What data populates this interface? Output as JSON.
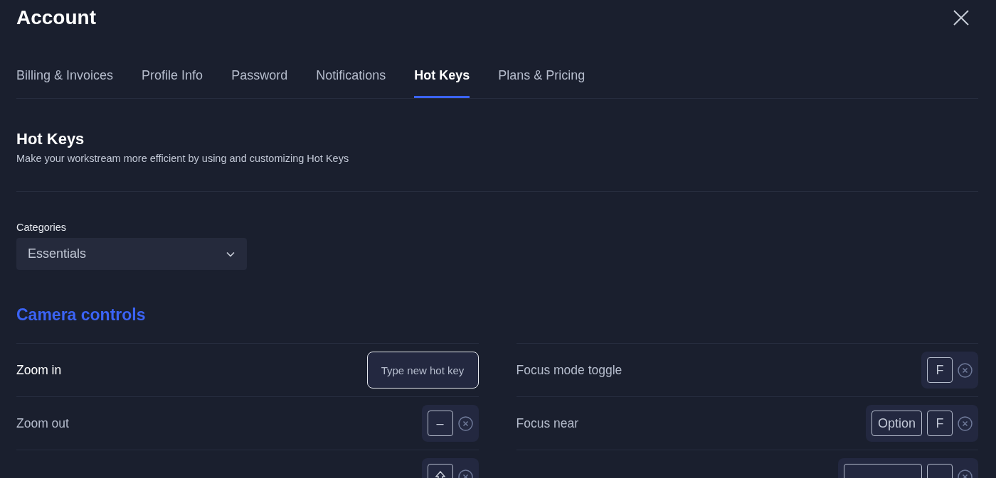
{
  "window": {
    "title": "Account"
  },
  "tabs": [
    {
      "label": "Billing & Invoices",
      "selected": false
    },
    {
      "label": "Profile Info",
      "selected": false
    },
    {
      "label": "Password",
      "selected": false
    },
    {
      "label": "Notifications",
      "selected": false
    },
    {
      "label": "Hot Keys",
      "selected": true
    },
    {
      "label": "Plans & Pricing",
      "selected": false
    }
  ],
  "section": {
    "title": "Hot Keys",
    "description": "Make your workstream more efficient by using and customizing Hot Keys"
  },
  "categories": {
    "label": "Categories",
    "value": "Essentials"
  },
  "group": {
    "title": "Camera controls",
    "rows": [
      {
        "label": "Zoom in",
        "editing": true,
        "placeholder": "Type new hot key",
        "keys": []
      },
      {
        "label": "Focus mode toggle",
        "editing": false,
        "keys": [
          {
            "kind": "text",
            "text": "F"
          }
        ]
      },
      {
        "label": "Zoom out",
        "editing": false,
        "keys": [
          {
            "kind": "text",
            "text": "–"
          }
        ]
      },
      {
        "label": "Focus near",
        "editing": false,
        "keys": [
          {
            "kind": "text",
            "text": "Option"
          },
          {
            "kind": "text",
            "text": "F"
          }
        ]
      },
      {
        "editing": false,
        "keys": [
          {
            "kind": "shift"
          }
        ]
      },
      {
        "editing": false,
        "keys": [
          {
            "kind": "wide"
          },
          {
            "kind": "blank"
          }
        ]
      }
    ]
  }
}
